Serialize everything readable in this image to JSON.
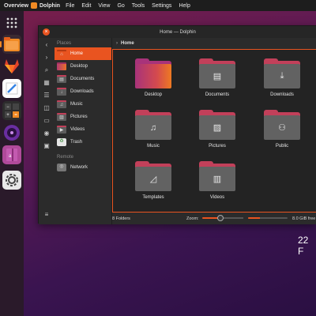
{
  "topbar": {
    "overview": "Overview",
    "app_name": "Dolphin",
    "menu": [
      "File",
      "Edit",
      "View",
      "Go",
      "Tools",
      "Settings",
      "Help"
    ]
  },
  "dock": {
    "items": [
      "app-grid-icon",
      "files-icon",
      "gitlab-icon",
      "text-editor-icon",
      "calculator-icon",
      "music-player-icon",
      "dictionary-icon",
      "settings-icon"
    ]
  },
  "desktop": {
    "date_partial": "22 F"
  },
  "window": {
    "title": "Home — Dolphin",
    "sidebar": {
      "places_title": "Places",
      "places": [
        {
          "label": "Home",
          "icon": "home-icon",
          "active": true
        },
        {
          "label": "Desktop",
          "icon": "desktop-folder-icon",
          "active": false
        },
        {
          "label": "Documents",
          "icon": "documents-folder-icon",
          "active": false
        },
        {
          "label": "Downloads",
          "icon": "downloads-folder-icon",
          "active": false
        },
        {
          "label": "Music",
          "icon": "music-folder-icon",
          "active": false
        },
        {
          "label": "Pictures",
          "icon": "pictures-folder-icon",
          "active": false
        },
        {
          "label": "Videos",
          "icon": "videos-folder-icon",
          "active": false
        },
        {
          "label": "Trash",
          "icon": "trash-icon",
          "active": false
        }
      ],
      "remote_title": "Remote",
      "remote": [
        {
          "label": "Network",
          "icon": "network-icon"
        }
      ]
    },
    "breadcrumb": "Home",
    "folders": [
      {
        "label": "Desktop",
        "icon": "desktop-folder-icon"
      },
      {
        "label": "Documents",
        "icon": "document-glyph-icon"
      },
      {
        "label": "Downloads",
        "icon": "download-glyph-icon"
      },
      {
        "label": "Music",
        "icon": "music-note-icon"
      },
      {
        "label": "Pictures",
        "icon": "picture-glyph-icon"
      },
      {
        "label": "Public",
        "icon": "people-glyph-icon"
      },
      {
        "label": "Templates",
        "icon": "template-glyph-icon"
      },
      {
        "label": "Videos",
        "icon": "film-glyph-icon"
      }
    ],
    "status": {
      "folder_count": "8 Folders",
      "zoom_label": "Zoom:",
      "zoom_level": 0.45,
      "free_space": "8.0 GiB free",
      "disk_used_fraction": 0.3
    }
  },
  "colors": {
    "accent": "#e95420",
    "folder_tab": "#c2405a",
    "folder_body": "#626262",
    "window_bg": "#2b2b2b",
    "content_bg": "#232323"
  }
}
